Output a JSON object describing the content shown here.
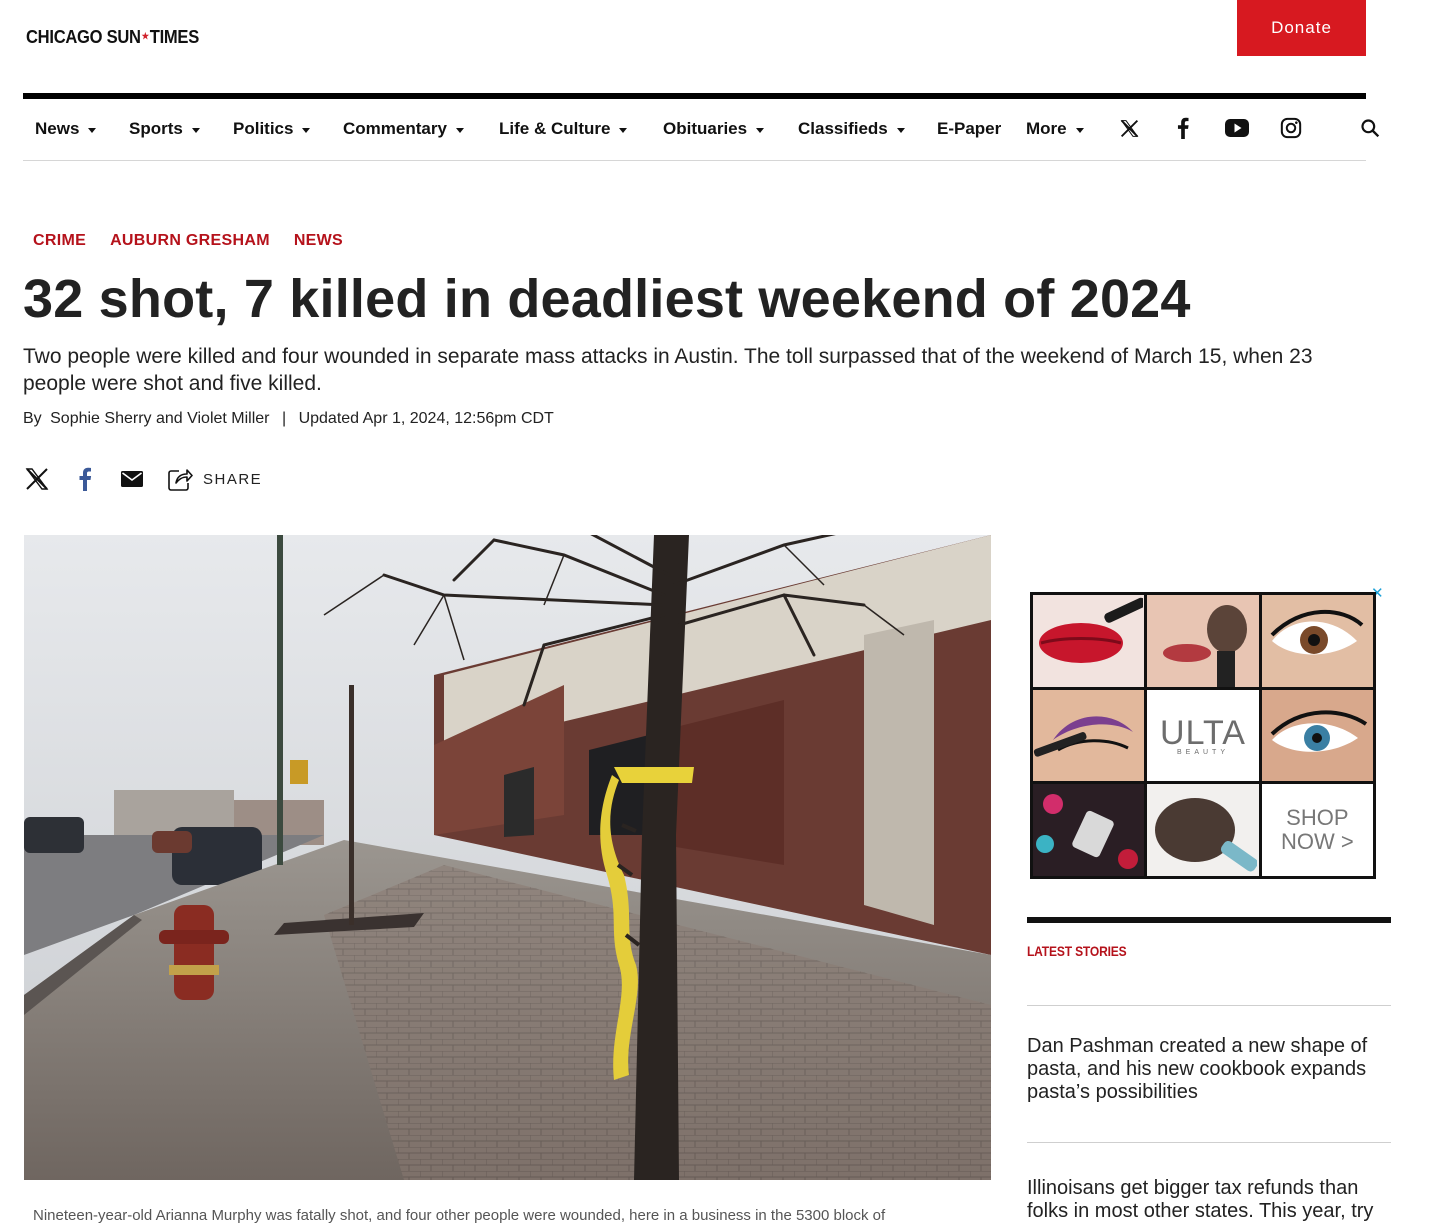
{
  "header": {
    "logo_left": "CHICAGO SUN",
    "logo_star": "★",
    "logo_right": "TIMES",
    "donate_label": "Donate"
  },
  "nav": {
    "items": [
      {
        "label": "News"
      },
      {
        "label": "Sports"
      },
      {
        "label": "Politics"
      },
      {
        "label": "Commentary"
      },
      {
        "label": "Life & Culture"
      },
      {
        "label": "Obituaries"
      },
      {
        "label": "Classifieds"
      },
      {
        "label": "E-Paper"
      },
      {
        "label": "More"
      }
    ],
    "social_icons": [
      "x-icon",
      "facebook-icon",
      "youtube-icon",
      "instagram-icon"
    ],
    "search_icon": "search-icon"
  },
  "article": {
    "categories": [
      "CRIME",
      "AUBURN GRESHAM",
      "NEWS"
    ],
    "headline": "32 shot, 7 killed in deadliest weekend of 2024",
    "dek": "Two people were killed and four wounded in separate mass attacks in Austin. The toll surpassed that of the weekend of March 15, when 23 people were shot and five killed.",
    "by_prefix": "By",
    "authors": "Sophie Sherry and Violet Miller",
    "separator": "|",
    "updated": "Updated Apr 1, 2024, 12:56pm CDT",
    "share_label": "SHARE",
    "caption": "Nineteen-year-old Arianna Murphy was fatally shot, and four other people were wounded, here in a business in the 5300 block of"
  },
  "sidebar": {
    "ad": {
      "brand": "ULTA",
      "brand_sub": "BEAUTY",
      "cta_line1": "SHOP",
      "cta_line2": "NOW >",
      "close": "✕"
    },
    "latest_title": "LATEST STORIES",
    "stories": [
      {
        "title": "Dan Pashman created a new shape of pasta, and his new cookbook expands pasta’s possibilities"
      },
      {
        "title": "Illinoisans get bigger tax refunds than folks in most other states. This year, try"
      }
    ]
  },
  "colors": {
    "brand_red": "#d71920",
    "category_red": "#b5121b",
    "text": "#222222"
  }
}
